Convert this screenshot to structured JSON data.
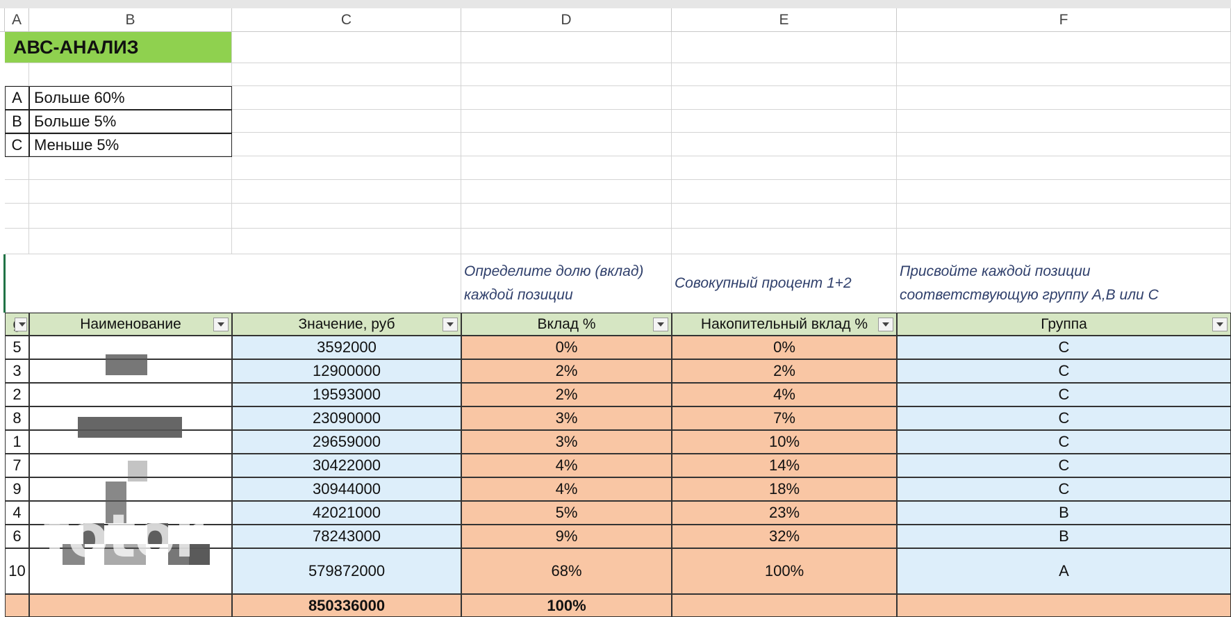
{
  "columns": [
    "A",
    "B",
    "C",
    "D",
    "E",
    "F"
  ],
  "title": "АВС-АНАЛИЗ",
  "legend": [
    {
      "code": "A",
      "label": "Больше 60%"
    },
    {
      "code": "B",
      "label": "Больше 5%"
    },
    {
      "code": "C",
      "label": "Меньше 5%"
    }
  ],
  "notes": {
    "d": "Определите долю (вклад) каждой позиции",
    "e": "Совокупный процент 1+2",
    "f": "Присвойте каждой позиции соответствующую группу А,В или С"
  },
  "headers": {
    "a": "g",
    "b": "Наименование",
    "c": "Значение, руб",
    "d": "Вклад %",
    "e": "Накопительный вклад %",
    "f": "Группа"
  },
  "rows": [
    {
      "n": "5",
      "value": "3592000",
      "share": "0%",
      "cum": "0%",
      "group": "C"
    },
    {
      "n": "3",
      "value": "12900000",
      "share": "2%",
      "cum": "2%",
      "group": "C"
    },
    {
      "n": "2",
      "value": "19593000",
      "share": "2%",
      "cum": "4%",
      "group": "C"
    },
    {
      "n": "8",
      "value": "23090000",
      "share": "3%",
      "cum": "7%",
      "group": "C"
    },
    {
      "n": "1",
      "value": "29659000",
      "share": "3%",
      "cum": "10%",
      "group": "C"
    },
    {
      "n": "7",
      "value": "30422000",
      "share": "4%",
      "cum": "14%",
      "group": "C"
    },
    {
      "n": "9",
      "value": "30944000",
      "share": "4%",
      "cum": "18%",
      "group": "C"
    },
    {
      "n": "4",
      "value": "42021000",
      "share": "5%",
      "cum": "23%",
      "group": "B"
    },
    {
      "n": "6",
      "value": "78243000",
      "share": "9%",
      "cum": "32%",
      "group": "B"
    },
    {
      "n": "10",
      "value": "579872000",
      "share": "68%",
      "cum": "100%",
      "group": "A"
    }
  ],
  "total": {
    "value": "850336000",
    "share": "100%"
  },
  "watermark": "fotor",
  "colors": {
    "title": "#8fd14f",
    "header": "#d6e6c3",
    "blue": "#ddeefa",
    "peach": "#f9c6a4",
    "note": "#2f3f6b"
  }
}
